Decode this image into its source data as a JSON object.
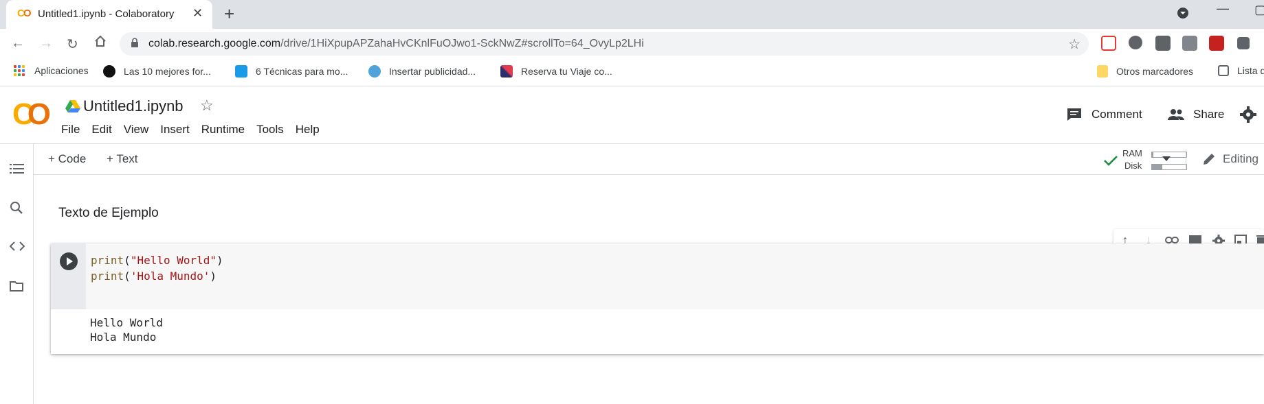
{
  "browser": {
    "tab_title": "Untitled1.ipynb - Colaboratory",
    "url_host": "colab.research.google.com",
    "url_path": "/drive/1HiXpupAPZahaHvCKnlFuOJwo1-SckNwZ#scrollTo=64_OvyLp2LHi",
    "bookmarks": [
      {
        "label": "Aplicaciones",
        "icon": "apps-grid-icon"
      },
      {
        "label": "Las 10 mejores for...",
        "icon": "vo-icon"
      },
      {
        "label": "6 Técnicas para mo...",
        "icon": "dollar-badge-icon"
      },
      {
        "label": "Insertar publicidad...",
        "icon": "bulb-icon"
      },
      {
        "label": "Reserva tu Viaje co...",
        "icon": "x-logo-icon"
      }
    ],
    "other_bookmarks": "Otros marcadores",
    "reading_list": "Lista d"
  },
  "colab": {
    "logo_c": "C",
    "logo_o": "O",
    "notebook_title": "Untitled1.ipynb",
    "menu": [
      "File",
      "Edit",
      "View",
      "Insert",
      "Runtime",
      "Tools",
      "Help"
    ],
    "comment_label": "Comment",
    "share_label": "Share",
    "toolbar": {
      "add_code": "+ Code",
      "add_text": "+ Text",
      "ram_label": "RAM",
      "disk_label": "Disk",
      "ram_usage": 0.03,
      "disk_usage": 0.3,
      "editing_label": "Editing"
    },
    "text_cell": "Texto de Ejemplo",
    "code_cell": {
      "line1_fn": "print",
      "line1_open": "(",
      "line1_str": "\"Hello World\"",
      "line1_close": ")",
      "line2_fn": "print",
      "line2_open": "(",
      "line2_str": "'Hola Mundo'",
      "line2_close": ")"
    },
    "output": [
      "Hello World",
      "Hola Mundo"
    ]
  },
  "colors": {
    "accent_orange": "#e8710a",
    "accent_yellow": "#f9ab00",
    "check_green": "#1e8e3e"
  }
}
